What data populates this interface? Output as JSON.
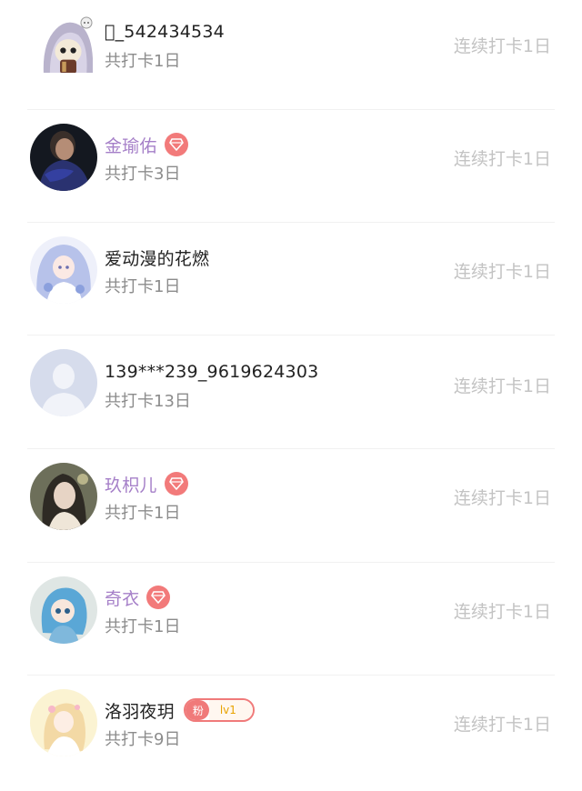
{
  "checkin_list": {
    "rows": [
      {
        "name": "\u0000_542434534",
        "total": "共打卡1日",
        "streak": "连续打卡1日",
        "badge": "none",
        "avatar": "hooded-chibi-avatar"
      },
      {
        "name": "金瑜佑",
        "total": "共打卡3日",
        "streak": "连续打卡1日",
        "badge": "vip-diamond",
        "avatar": "dark-photo-avatar"
      },
      {
        "name": "爱动漫的花燃",
        "total": "共打卡1日",
        "streak": "连续打卡1日",
        "badge": "none",
        "avatar": "anime-girl-avatar"
      },
      {
        "name": "139***239_9619624303",
        "total": "共打卡13日",
        "streak": "连续打卡1日",
        "badge": "none",
        "avatar": "default-person-avatar"
      },
      {
        "name": "玖枳儿",
        "total": "共打卡1日",
        "streak": "连续打卡1日",
        "badge": "vip-diamond",
        "avatar": "portrait-photo-avatar"
      },
      {
        "name": "奇衣",
        "total": "共打卡1日",
        "streak": "连续打卡1日",
        "badge": "vip-diamond",
        "avatar": "blue-doll-avatar"
      },
      {
        "name": "洛羽夜玥",
        "total": "共打卡9日",
        "streak": "连续打卡1日",
        "badge": "fan-level",
        "fan_tag": "粉",
        "fan_level": "lv1",
        "avatar": "card-anime-avatar"
      }
    ]
  },
  "colors": {
    "vip_name": "#a57fc8",
    "normal_name": "#222222",
    "total_text": "#8c8c8c",
    "streak_text": "#c3c3c3",
    "vip_badge": "#f27a7a",
    "divider": "#f1f1f1"
  }
}
